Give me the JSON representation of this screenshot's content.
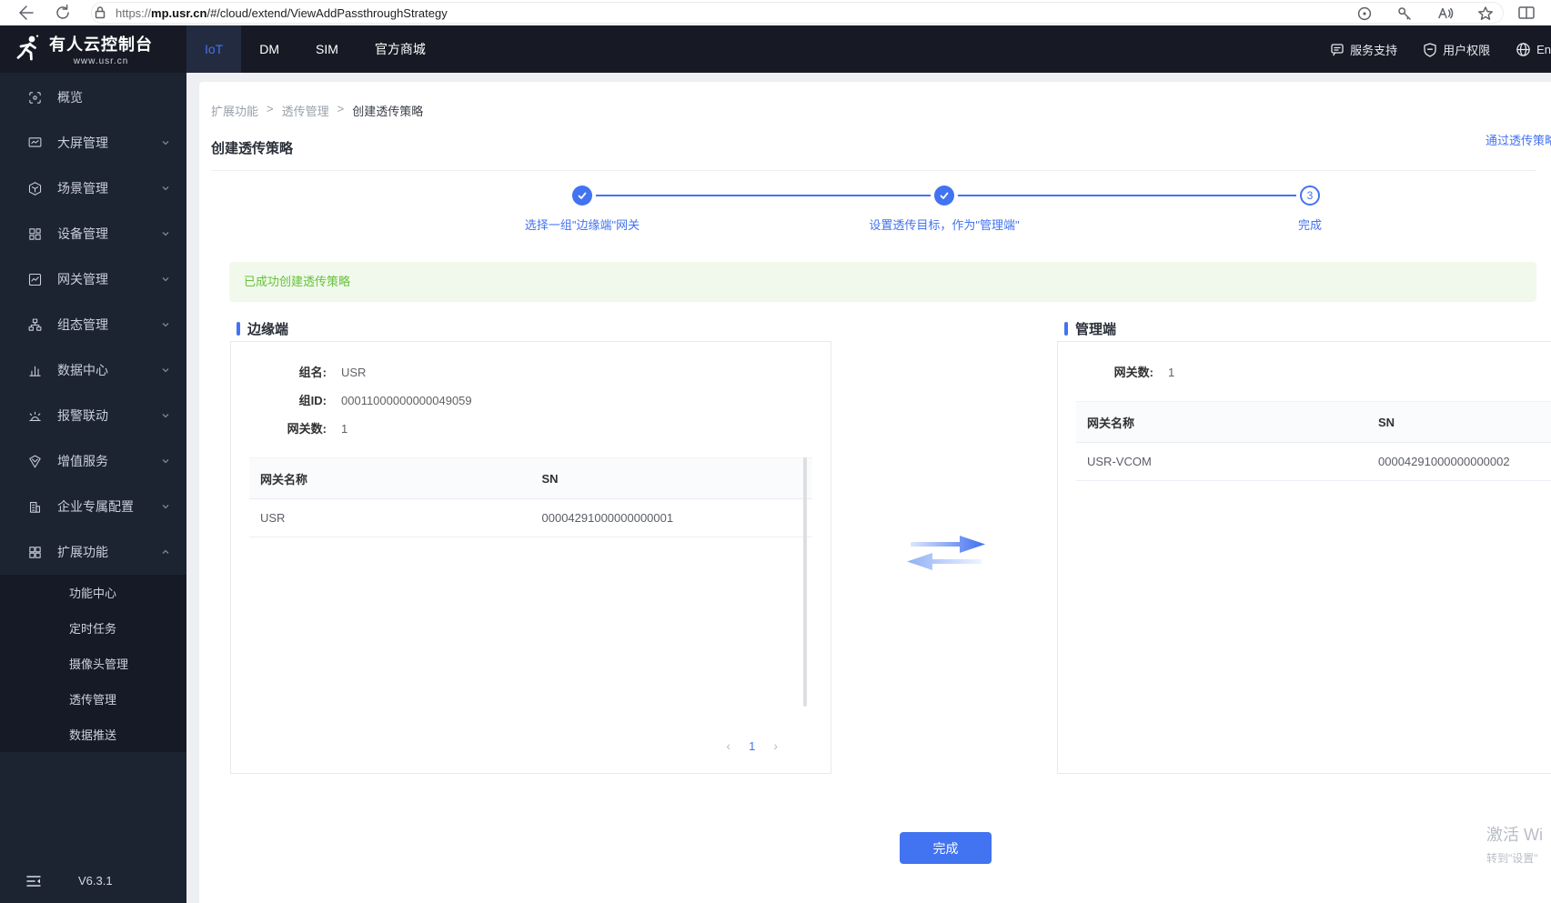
{
  "browser": {
    "url_protocol": "https://",
    "url_host": "mp.usr.cn",
    "url_path": "/#/cloud/extend/ViewAddPassthroughStrategy"
  },
  "navbar": {
    "logo_title": "有人云控制台",
    "logo_subtitle": "www.usr.cn",
    "tabs": [
      {
        "label": "IoT"
      },
      {
        "label": "DM"
      },
      {
        "label": "SIM"
      },
      {
        "label": "官方商城"
      }
    ],
    "support": "服务支持",
    "permissions": "用户权限",
    "language": "En"
  },
  "sidebar": {
    "items": [
      {
        "label": "概览"
      },
      {
        "label": "大屏管理"
      },
      {
        "label": "场景管理"
      },
      {
        "label": "设备管理"
      },
      {
        "label": "网关管理"
      },
      {
        "label": "组态管理"
      },
      {
        "label": "数据中心"
      },
      {
        "label": "报警联动"
      },
      {
        "label": "增值服务"
      },
      {
        "label": "企业专属配置"
      },
      {
        "label": "扩展功能"
      }
    ],
    "submenu": [
      {
        "label": "功能中心"
      },
      {
        "label": "定时任务"
      },
      {
        "label": "摄像头管理"
      },
      {
        "label": "透传管理"
      },
      {
        "label": "数据推送"
      }
    ],
    "version": "V6.3.1"
  },
  "page": {
    "breadcrumb": [
      "扩展功能",
      "透传管理",
      "创建透传策略"
    ],
    "separator": ">",
    "title": "创建透传策略",
    "top_link": "通过透传策略",
    "steps": [
      {
        "label": "选择一组\"边缘端\"网关"
      },
      {
        "label": "设置透传目标，作为\"管理端\""
      },
      {
        "label": "完成",
        "number": "3"
      }
    ],
    "success_message": "已成功创建透传策略",
    "finish_button": "完成"
  },
  "edge_panel": {
    "title": "边缘端",
    "fields": [
      {
        "label": "组名:",
        "value": "USR"
      },
      {
        "label": "组ID:",
        "value": "00011000000000049059"
      },
      {
        "label": "网关数:",
        "value": "1"
      }
    ],
    "table": {
      "headers": [
        "网关名称",
        "SN"
      ],
      "rows": [
        [
          "USR",
          "00004291000000000001"
        ]
      ]
    },
    "pagination": {
      "prev": "‹",
      "current_page": "1",
      "next": "›"
    }
  },
  "manage_panel": {
    "title": "管理端",
    "fields": [
      {
        "label": "网关数:",
        "value": "1"
      }
    ],
    "table": {
      "headers": [
        "网关名称",
        "SN"
      ],
      "rows": [
        [
          "USR-VCOM",
          "00004291000000000002"
        ]
      ]
    }
  },
  "watermark": {
    "line1": "激活 Wi",
    "line2": "转到\"设置\""
  },
  "colors": {
    "primary": "#4273f0",
    "success_text": "#67c23a",
    "success_bg": "#f0f9eb",
    "navbar_bg": "#171a24",
    "sidebar_bg": "#1d2431",
    "submenu_bg": "#151a26"
  }
}
